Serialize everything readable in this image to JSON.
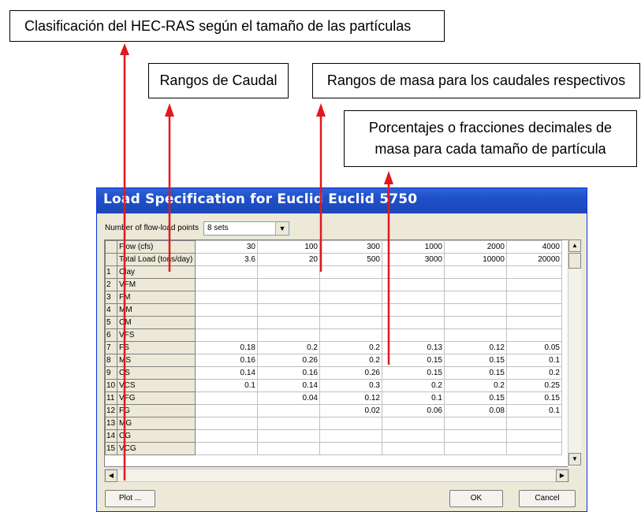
{
  "callouts": {
    "hec_ras_class": "Clasificación del HEC-RAS según el tamaño de las partículas",
    "flow_ranges": "Rangos de Caudal",
    "mass_ranges": "Rangos de masa para los caudales respectivos",
    "percentages_line1": "Porcentajes o fracciones decimales de",
    "percentages_line2": "masa para cada tamaño de partícula"
  },
  "colors": {
    "arrow": "#e0191e",
    "title_bar": "#1f50c8"
  },
  "dialog": {
    "title": "Load Specification for Euclid Euclid 5750",
    "flow_load_label": "Number of flow-load points",
    "sets_value": "8 sets",
    "buttons": {
      "plot": "Plot ...",
      "ok": "OK",
      "cancel": "Cancel"
    }
  },
  "table": {
    "header_rows": [
      {
        "label": "Flow (cfs)",
        "values": [
          "30",
          "100",
          "300",
          "1000",
          "2000",
          "4000"
        ]
      },
      {
        "label": "Total Load (tons/day)",
        "values": [
          "3.6",
          "20",
          "500",
          "3000",
          "10000",
          "20000"
        ]
      }
    ],
    "rows": [
      {
        "num": "1",
        "label": "Clay",
        "values": [
          "",
          "",
          "",
          "",
          "",
          ""
        ]
      },
      {
        "num": "2",
        "label": "VFM",
        "values": [
          "",
          "",
          "",
          "",
          "",
          ""
        ]
      },
      {
        "num": "3",
        "label": "FM",
        "values": [
          "",
          "",
          "",
          "",
          "",
          ""
        ]
      },
      {
        "num": "4",
        "label": "MM",
        "values": [
          "",
          "",
          "",
          "",
          "",
          ""
        ]
      },
      {
        "num": "5",
        "label": "CM",
        "values": [
          "",
          "",
          "",
          "",
          "",
          ""
        ]
      },
      {
        "num": "6",
        "label": "VFS",
        "values": [
          "",
          "",
          "",
          "",
          "",
          ""
        ]
      },
      {
        "num": "7",
        "label": "FS",
        "values": [
          "0.18",
          "0.2",
          "0.2",
          "0.13",
          "0.12",
          "0.05"
        ]
      },
      {
        "num": "8",
        "label": "MS",
        "values": [
          "0.16",
          "0.26",
          "0.2",
          "0.15",
          "0.15",
          "0.1"
        ]
      },
      {
        "num": "9",
        "label": "CS",
        "values": [
          "0.14",
          "0.16",
          "0.26",
          "0.15",
          "0.15",
          "0.2"
        ]
      },
      {
        "num": "10",
        "label": "VCS",
        "values": [
          "0.1",
          "0.14",
          "0.3",
          "0.2",
          "0.2",
          "0.25"
        ]
      },
      {
        "num": "11",
        "label": "VFG",
        "values": [
          "",
          "0.04",
          "0.12",
          "0.1",
          "0.15",
          "0.15"
        ]
      },
      {
        "num": "12",
        "label": "FG",
        "values": [
          "",
          "",
          "0.02",
          "0.06",
          "0.08",
          "0.1"
        ]
      },
      {
        "num": "13",
        "label": "MG",
        "values": [
          "",
          "",
          "",
          "",
          "",
          ""
        ]
      },
      {
        "num": "14",
        "label": "CG",
        "values": [
          "",
          "",
          "",
          "",
          "",
          ""
        ]
      },
      {
        "num": "15",
        "label": "VCG",
        "values": [
          "",
          "",
          "",
          "",
          "",
          ""
        ]
      }
    ]
  }
}
